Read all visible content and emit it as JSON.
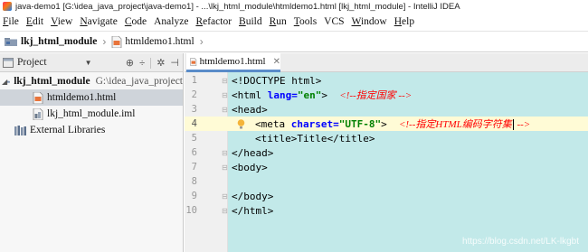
{
  "window": {
    "title": "java-demo1 [G:\\idea_java_project\\java-demo1] - ...\\lkj_html_module\\htmldemo1.html [lkj_html_module] - IntelliJ IDEA"
  },
  "menu": [
    {
      "mnemonic": "F",
      "rest": "ile"
    },
    {
      "mnemonic": "E",
      "rest": "dit"
    },
    {
      "mnemonic": "V",
      "rest": "iew"
    },
    {
      "mnemonic": "N",
      "rest": "avigate"
    },
    {
      "mnemonic": "C",
      "rest": "ode"
    },
    {
      "mnemonic": "",
      "rest": "Analyze"
    },
    {
      "mnemonic": "R",
      "rest": "efactor"
    },
    {
      "mnemonic": "B",
      "rest": "uild"
    },
    {
      "mnemonic": "R",
      "rest": "un"
    },
    {
      "mnemonic": "T",
      "rest": "ools"
    },
    {
      "mnemonic": "",
      "rest": "VCS"
    },
    {
      "mnemonic": "W",
      "rest": "indow"
    },
    {
      "mnemonic": "H",
      "rest": "elp"
    }
  ],
  "breadcrumb": {
    "project": "lkj_html_module",
    "file": "htmldemo1.html"
  },
  "project_panel": {
    "title": "Project",
    "tree": {
      "module_name": "lkj_html_module",
      "module_path": "G:\\idea_java_project",
      "file1": "htmldemo1.html",
      "file2": "lkj_html_module.iml",
      "libraries": "External Libraries"
    }
  },
  "editor": {
    "tab_label": "htmldemo1.html",
    "line_numbers": [
      "1",
      "2",
      "3",
      "4",
      "5",
      "6",
      "7",
      "8",
      "9",
      "10"
    ],
    "line1": "<!DOCTYPE html>",
    "line2_open": "<html",
    "line2_attr": " lang=",
    "line2_val": "\"en\"",
    "line2_close": ">",
    "line2_comment": "<!--指定国家 -->",
    "line3": "<head>",
    "line4_open": "<meta",
    "line4_attr": " charset=",
    "line4_val": "\"UTF-8\"",
    "line4_close": ">",
    "line4_comment_a": "<!--指定HTML编码字符集",
    "line4_comment_b": " -->",
    "line5_open": "<title>",
    "line5_text": "Title",
    "line5_close": "</title>",
    "line6": "</head>",
    "line7": "<body>",
    "line9": "</body>",
    "line10": "</html>"
  },
  "watermark": "https://blog.csdn.net/LK-lkgbt",
  "colors": {
    "code_background": "#c2e9e9",
    "current_line": "#fffbd6",
    "tag": "#000080",
    "attribute": "#0000ff",
    "string": "#008000",
    "comment": "#ff0000"
  }
}
